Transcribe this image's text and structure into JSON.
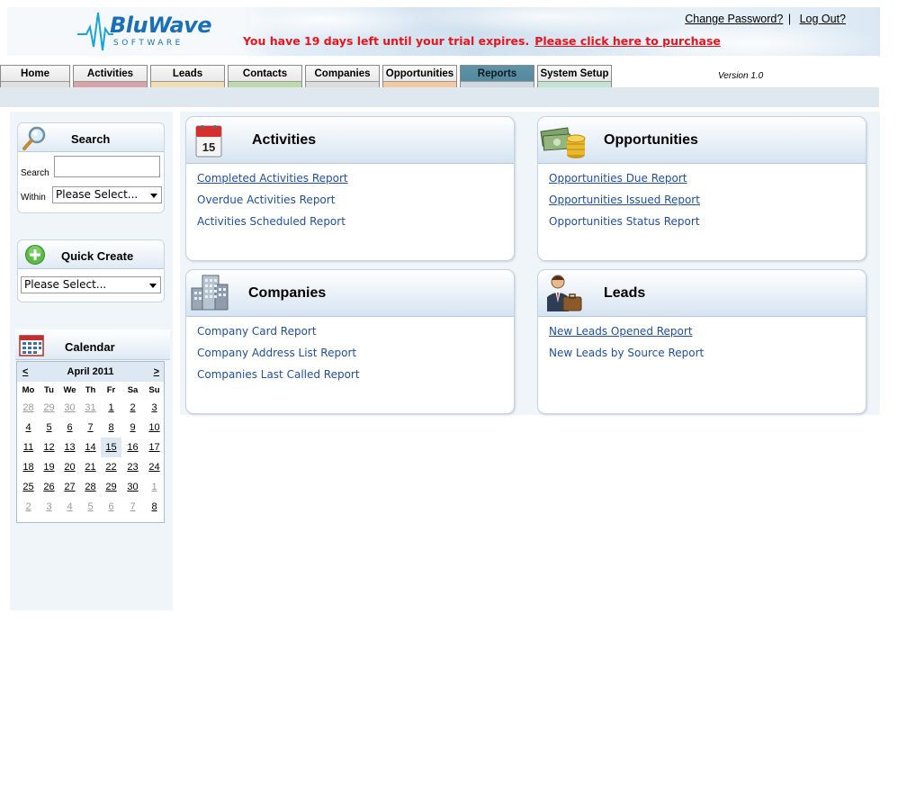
{
  "header": {
    "logo_text": "BluWave",
    "logo_sub": "SOFTWARE",
    "trial_message": "You have 19 days left until your trial expires.",
    "purchase_link": "Please click here to purchase",
    "change_password": "Change Password?",
    "separator": "|",
    "logout": "Log Out?"
  },
  "nav": {
    "tabs": [
      {
        "label": "Home",
        "color": "#e0e0e0"
      },
      {
        "label": "Activities",
        "color": "#d9a3a8"
      },
      {
        "label": "Leads",
        "color": "#f1dfb3"
      },
      {
        "label": "Contacts",
        "color": "#bfd9ae"
      },
      {
        "label": "Companies",
        "color": "#dcdcdc"
      },
      {
        "label": "Opportunities",
        "color": "#f4c99f"
      },
      {
        "label": "Reports",
        "color": "#cfd9e0"
      },
      {
        "label": "System Setup",
        "color": "#c3e5d0"
      }
    ],
    "active_tab": "Reports",
    "version": "Version 1.0"
  },
  "sidebar": {
    "search": {
      "title": "Search",
      "search_label": "Search",
      "search_value": "",
      "within_label": "Within",
      "within_value": "Please Select..."
    },
    "quick_create": {
      "title": "Quick Create",
      "select_value": "Please Select..."
    },
    "calendar": {
      "title": "Calendar",
      "month": "April 2011",
      "prev": "<",
      "next": ">",
      "days_of_week": [
        "Mo",
        "Tu",
        "We",
        "Th",
        "Fr",
        "Sa",
        "Su"
      ],
      "weeks": [
        [
          "28",
          "29",
          "30",
          "31",
          "1",
          "2",
          "3"
        ],
        [
          "4",
          "5",
          "6",
          "7",
          "8",
          "9",
          "10"
        ],
        [
          "11",
          "12",
          "13",
          "14",
          "15",
          "16",
          "17"
        ],
        [
          "18",
          "19",
          "20",
          "21",
          "22",
          "23",
          "24"
        ],
        [
          "25",
          "26",
          "27",
          "28",
          "29",
          "30",
          "1"
        ],
        [
          "2",
          "3",
          "4",
          "5",
          "6",
          "7",
          "8"
        ]
      ],
      "today": "15"
    }
  },
  "panels": {
    "activities": {
      "title": "Activities",
      "icon_text": "15",
      "links": [
        "Completed Activities Report",
        "Overdue Activities Report",
        "Activities Scheduled Report"
      ]
    },
    "opportunities": {
      "title": "Opportunities",
      "links": [
        "Opportunities Due Report",
        "Opportunities Issued Report",
        "Opportunities Status Report"
      ]
    },
    "companies": {
      "title": "Companies",
      "links": [
        "Company Card Report",
        "Company Address List Report",
        "Companies Last Called Report"
      ]
    },
    "leads": {
      "title": "Leads",
      "links": [
        "New Leads Opened Report",
        "New Leads by Source Report"
      ]
    }
  },
  "icons": {
    "logo": "bluwave-wave-logo",
    "search": "magnifier-icon",
    "quick_create": "plus-circle-icon",
    "calendar": "calendar-grid-icon",
    "activities": "calendar-page-icon",
    "opportunities": "money-coins-icon",
    "companies": "buildings-icon",
    "leads": "businessman-icon"
  }
}
